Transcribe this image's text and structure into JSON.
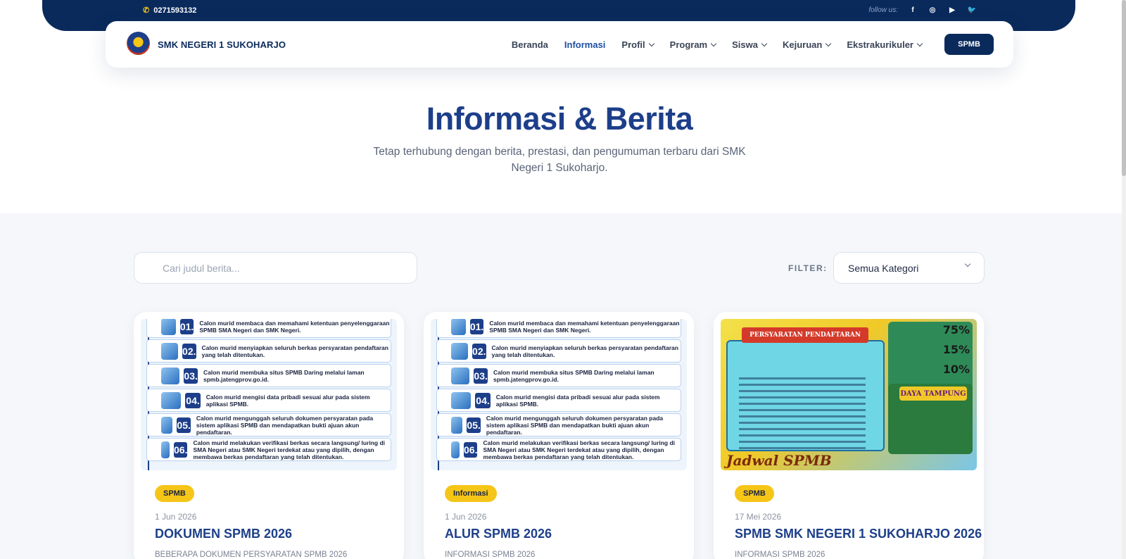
{
  "topbar": {
    "phone": "0271593132",
    "follow_label": "follow us:",
    "social": [
      "f",
      "◎",
      "▶",
      "🐦"
    ]
  },
  "navbar": {
    "brand": "SMK NEGERI 1 SUKOHARJO",
    "items": [
      {
        "label": "Beranda",
        "active": false,
        "dropdown": false
      },
      {
        "label": "Informasi",
        "active": true,
        "dropdown": false
      },
      {
        "label": "Profil",
        "active": false,
        "dropdown": true
      },
      {
        "label": "Program",
        "active": false,
        "dropdown": true
      },
      {
        "label": "Siswa",
        "active": false,
        "dropdown": true
      },
      {
        "label": "Kejuruan",
        "active": false,
        "dropdown": true
      },
      {
        "label": "Ekstrakurikuler",
        "active": false,
        "dropdown": true
      }
    ],
    "cta": "SPMB"
  },
  "hero": {
    "title": "Informasi & Berita",
    "subtitle": "Tetap terhubung dengan berita, prestasi, dan pengumuman terbaru dari SMK Negeri 1 Sukoharjo."
  },
  "filters": {
    "search_placeholder": "Cari judul berita...",
    "filter_label": "FILTER:",
    "category": "Semua Kategori"
  },
  "steps": [
    {
      "num": "01.",
      "text": "Calon murid membaca dan memahami ketentuan penyelenggaraan SPMB SMA Negeri dan SMK Negeri."
    },
    {
      "num": "02.",
      "text": "Calon murid menyiapkan seluruh berkas persyaratan pendaftaran yang telah ditentukan."
    },
    {
      "num": "03.",
      "text": "Calon murid membuka situs SPMB Daring melalui laman spmb.jatengprov.go.id."
    },
    {
      "num": "04.",
      "text": "Calon murid mengisi data pribadi sesuai alur pada sistem aplikasi SPMB."
    },
    {
      "num": "05.",
      "text": "Calon murid mengunggah seluruh dokumen persyaratan pada sistem aplikasi SPMB dan mendapatkan bukti ajuan akun pendaftaran."
    },
    {
      "num": "06.",
      "text": "Calon murid melakukan verifikasi berkas secara langsung/ luring di SMA Negeri atau SMK Negeri terdekat atau yang dipilih, dengan membawa berkas pendaftaran yang telah ditentukan."
    }
  ],
  "poster": {
    "heading": "PERSYARATAN PENDAFTARAN",
    "pct1": "75%",
    "pct2": "15%",
    "pct3": "10%",
    "daya": "DAYA TAMPUNG",
    "jadwal": "Jadwal SPMB"
  },
  "cards": [
    {
      "badge": "SPMB",
      "date": "1 Jun 2026",
      "title": "DOKUMEN SPMB 2026",
      "desc": "BEBERAPA DOKUMEN PERSYARATAN SPMB 2026"
    },
    {
      "badge": "Informasi",
      "date": "1 Jun 2026",
      "title": "ALUR SPMB 2026",
      "desc": "INFORMASI SPMB 2026"
    },
    {
      "badge": "SPMB",
      "date": "17 Mei 2026",
      "title": "SPMB SMK NEGERI 1 SUKOHARJO 2026",
      "desc": "INFORMASI SPMB 2026"
    }
  ],
  "colors": {
    "primary": "#0a2a5c",
    "accent": "#1d4fa3",
    "badge": "#f5c518",
    "section_bg": "#f5f7fa"
  }
}
